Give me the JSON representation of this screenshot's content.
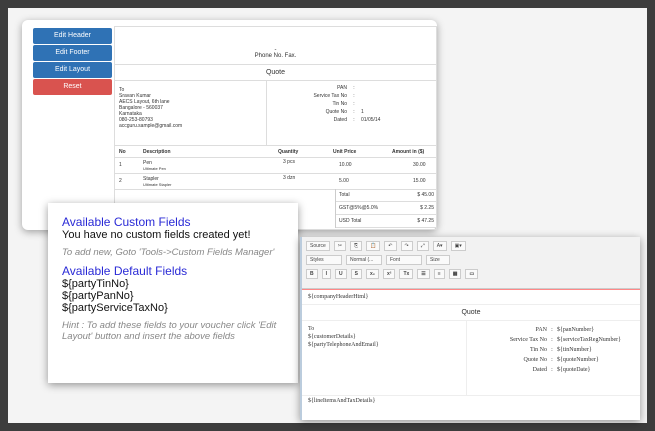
{
  "buttons": {
    "edit_header": "Edit Header",
    "edit_footer": "Edit Footer",
    "edit_layout": "Edit Layout",
    "reset": "Reset"
  },
  "preview": {
    "dash": "-",
    "phone": "Phone No. Fax.",
    "title": "Quote",
    "to": [
      "To",
      "Sravan Kumar",
      "AECS Layout, 6th lane",
      "Bangalore - 560037",
      "Karnataka",
      "080-253-80793",
      "accguru.sample@gmail.com"
    ],
    "info": [
      {
        "label": "PAN",
        "value": ""
      },
      {
        "label": "Service Tax No",
        "value": ""
      },
      {
        "label": "Tin No",
        "value": ""
      },
      {
        "label": "Quote No",
        "value": "1"
      },
      {
        "label": "Dated",
        "value": "01/05/14"
      }
    ],
    "headers": [
      "No",
      "Description",
      "Quantity",
      "Unit Price",
      "Amount in ($)"
    ],
    "items": [
      {
        "no": "1",
        "name": "Pen",
        "sub": "Ultimate Pen",
        "qty": "3 pcs",
        "price": "10.00",
        "amount": "30.00"
      },
      {
        "no": "2",
        "name": "Stapler",
        "sub": "Ultimate Stapler",
        "qty": "3 dzn",
        "price": "5.00",
        "amount": "15.00"
      }
    ],
    "totals": [
      {
        "label": "Total",
        "value": "$ 45.00"
      },
      {
        "label": "GST@5%@5.0%",
        "value": "$ 2.25"
      },
      {
        "label": "USD Total",
        "value": "$ 47.25"
      }
    ]
  },
  "fields": {
    "custom_title": "Available Custom Fields",
    "custom_empty": "You have no custom fields created yet!",
    "custom_hint": "To add new, Goto 'Tools->Custom Fields Manager'",
    "default_title": "Available Default Fields",
    "defaults": [
      "${partyTinNo}",
      "${partyPanNo}",
      "${partyServiceTaxNo}"
    ],
    "default_hint": "Hint : To add these fields to your voucher click 'Edit Layout' button and insert the above fields"
  },
  "editor": {
    "source": "Source",
    "styles": "Styles",
    "format": "Normal (...",
    "font": "Font",
    "size": "Size",
    "fmt": [
      "B",
      "I",
      "U",
      "S",
      "x₂",
      "x²",
      "Tx"
    ],
    "header": "${companyHeaderHtml}",
    "title": "Quote",
    "left": [
      "To",
      "${customerDetails}",
      "${partyTelephoneAndEmail}"
    ],
    "right": [
      {
        "label": "PAN",
        "value": "${panNumber}"
      },
      {
        "label": "Service Tax No",
        "value": "${serviceTaxRegNumber}"
      },
      {
        "label": "Tin No",
        "value": "${tinNumber}"
      },
      {
        "label": "Quote No",
        "value": "${quoteNumber}"
      },
      {
        "label": "Dated",
        "value": "${quoteDate}"
      }
    ],
    "lines": "${lineItemsAndTaxDetails}"
  }
}
